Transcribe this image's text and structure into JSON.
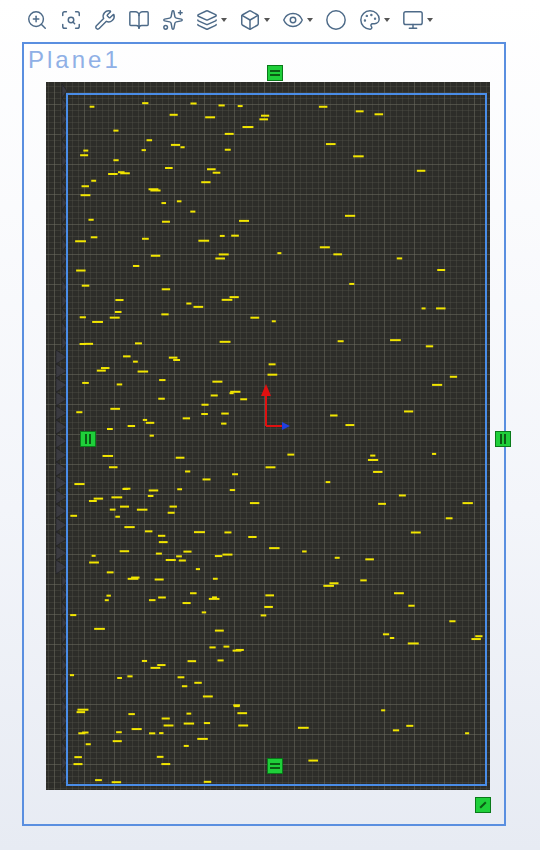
{
  "toolbar": {
    "buttons": [
      {
        "has_menu": false
      },
      {
        "has_menu": false
      },
      {
        "has_menu": false
      },
      {
        "has_menu": false
      },
      {
        "has_menu": false
      },
      {
        "has_menu": true
      },
      {
        "has_menu": true
      },
      {
        "has_menu": true
      },
      {
        "has_menu": false
      },
      {
        "has_menu": true
      },
      {
        "has_menu": true
      }
    ]
  },
  "viewport": {
    "plane": {
      "label": "Plane1",
      "selected": true
    },
    "handles": [
      {
        "kind": "edge"
      },
      {
        "kind": "side"
      },
      {
        "kind": "side"
      },
      {
        "kind": "edge"
      },
      {
        "kind": "corner"
      }
    ]
  }
}
